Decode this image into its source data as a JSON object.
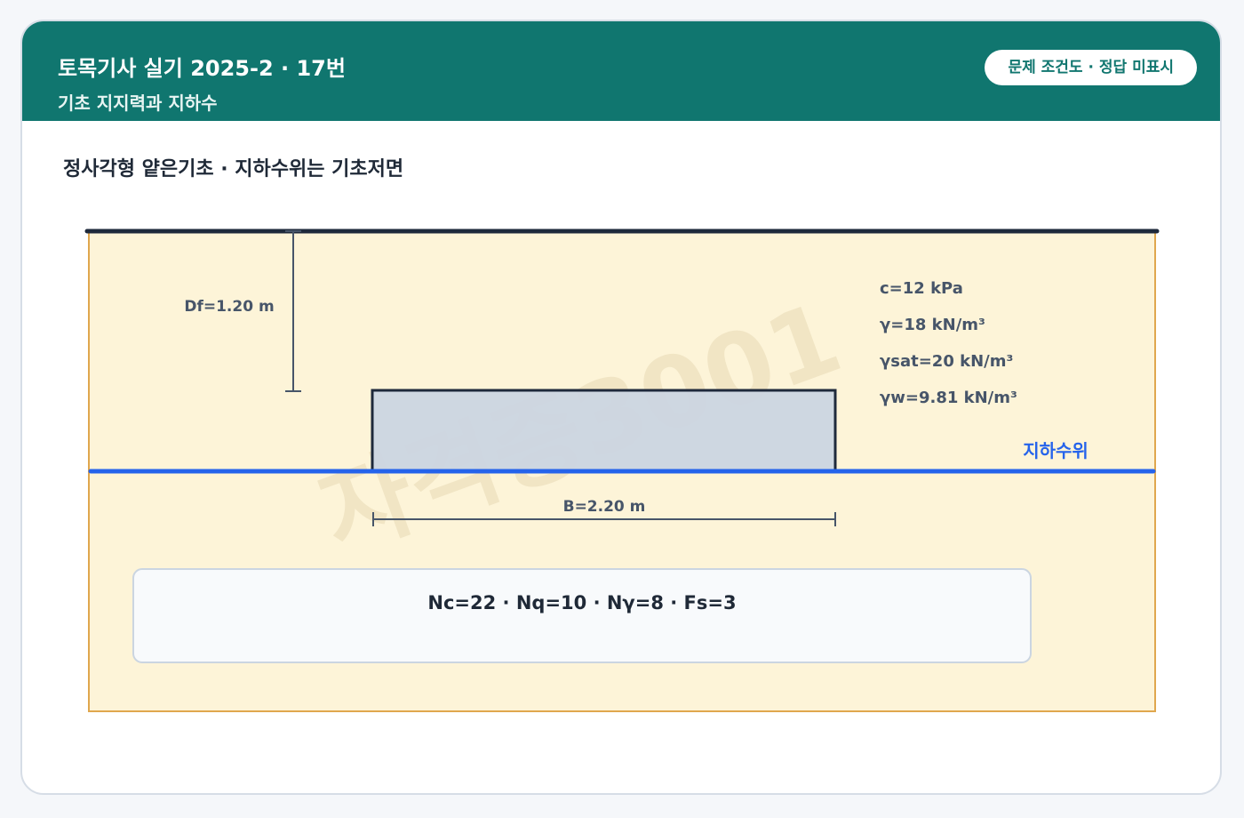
{
  "header": {
    "title": "토목기사 실기 2025-2 · 17번",
    "subtitle": "기초 지지력과 지하수",
    "badge": "문제 조건도 · 정답 미표시"
  },
  "section_title": "정사각형 얕은기초 · 지하수위는 기초저면",
  "diagram": {
    "df_label": "Df=1.20 m",
    "b_label": "B=2.20 m",
    "water_table_label": "지하수위",
    "soil_props": [
      "c=12 kPa",
      "γ=18 kN/m³",
      "γsat=20 kN/m³",
      "γw=9.81 kN/m³"
    ],
    "factors": "Nc=22 · Nq=10 · Nγ=8 · Fs=3",
    "watermark": "자격증3001"
  },
  "colors": {
    "header": "#10766f",
    "soil": "#fdf4d8",
    "soil_border": "#e0a74e",
    "footing": "#cbd5e1",
    "water_table": "#2563eb",
    "ground": "#1e293b"
  }
}
